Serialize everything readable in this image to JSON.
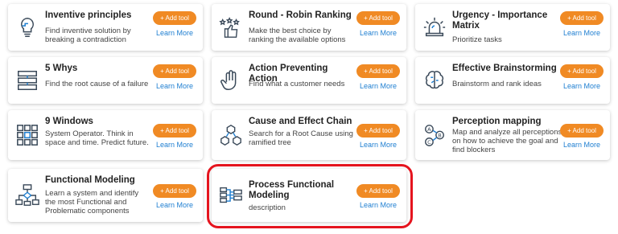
{
  "common": {
    "add_label": "+ Add tool",
    "learn_label": "Learn More"
  },
  "cards": [
    {
      "title": "Inventive principles",
      "description": "Find inventive solution by breaking a contradiction",
      "icon": "lightbulb-puzzle-icon"
    },
    {
      "title": "Round - Robin Ranking",
      "description": "Make the best choice by ranking the available options",
      "icon": "stars-thumbs-up-icon"
    },
    {
      "title": "Urgency - Importance Matrix",
      "description": "Prioritize tasks",
      "icon": "siren-icon"
    },
    {
      "title": "5 Whys",
      "description": "Find the root cause of a failure",
      "icon": "stacked-layers-icon"
    },
    {
      "title": "Action Preventing Action",
      "description": "Find what a customer needs",
      "icon": "raised-hand-icon"
    },
    {
      "title": "Effective Brainstorming",
      "description": "Brainstorm and rank ideas",
      "icon": "brain-icon"
    },
    {
      "title": "9 Windows",
      "description": "System Operator. Think in space and time. Predict future.",
      "icon": "grid-nine-icon"
    },
    {
      "title": "Cause and Effect Chain",
      "description": "Search for a Root Cause using ramified tree",
      "icon": "cubes-tree-icon"
    },
    {
      "title": "Perception mapping",
      "description": "Map and analyze all perceptions on how to achieve the goal and find blockers",
      "icon": "abc-nodes-icon"
    },
    {
      "title": "Functional Modeling",
      "description": "Learn a system and identify the most Functional and Problematic components",
      "icon": "flowchart-icon"
    },
    {
      "title": "Process Functional Modeling",
      "description": "description",
      "icon": "process-flow-icon"
    }
  ],
  "colors": {
    "accent": "#f08a24",
    "link": "#1f7fd1",
    "highlight": "#e5141e",
    "icon_stroke": "#3b4a5a"
  }
}
